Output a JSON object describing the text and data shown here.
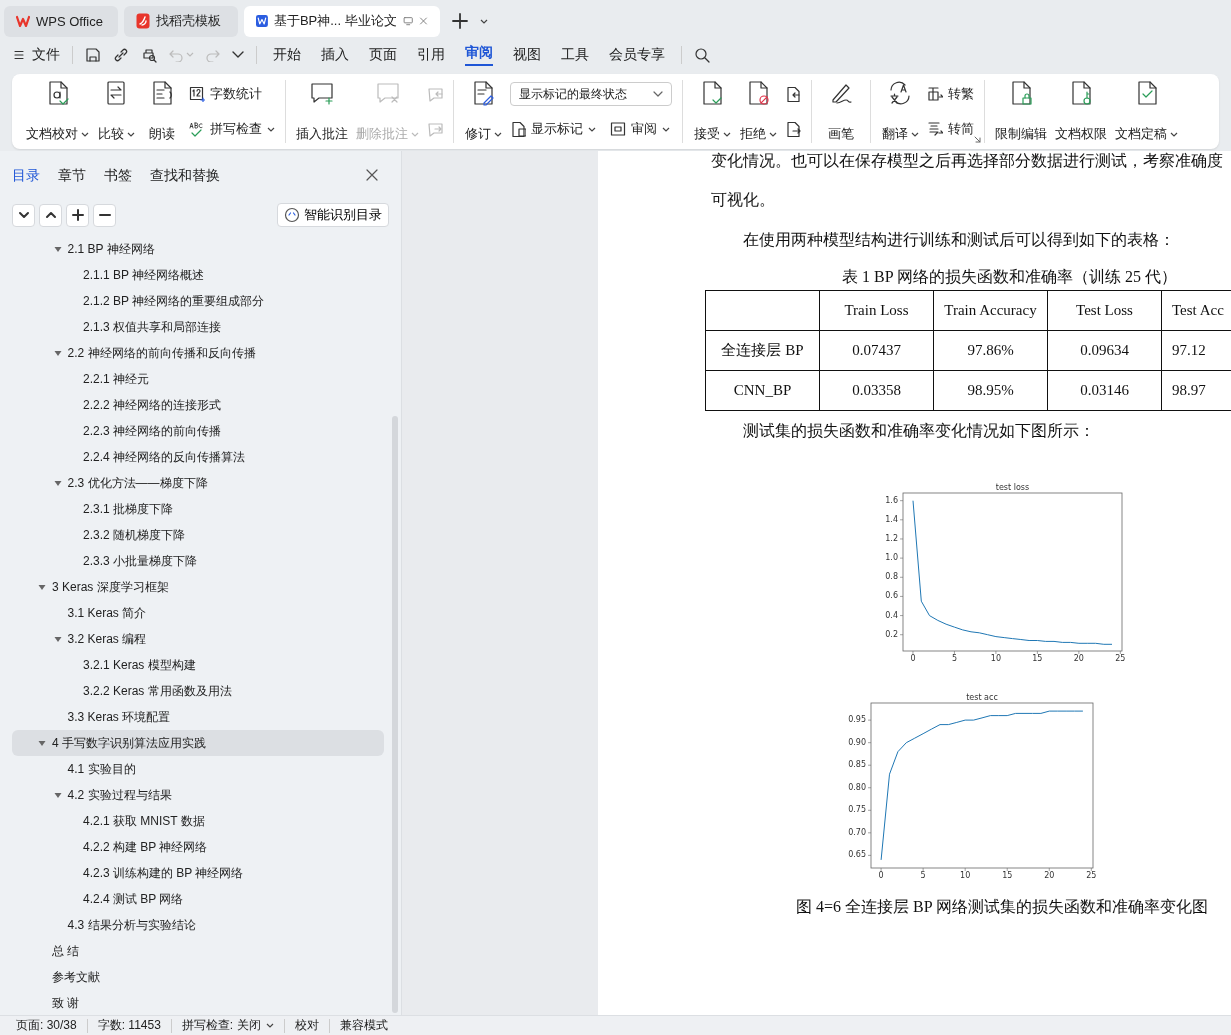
{
  "app_tabs": [
    {
      "kind": "home",
      "label": "WPS Office",
      "selected": false
    },
    {
      "kind": "template",
      "label": "找稻壳模板",
      "selected": false
    },
    {
      "kind": "doc",
      "label": "基于BP神... 毕业论文",
      "selected": true
    }
  ],
  "menu": {
    "file": "文件",
    "tabs": [
      {
        "label": "开始",
        "selected": false
      },
      {
        "label": "插入",
        "selected": false
      },
      {
        "label": "页面",
        "selected": false
      },
      {
        "label": "引用",
        "selected": false
      },
      {
        "label": "审阅",
        "selected": true
      },
      {
        "label": "视图",
        "selected": false
      },
      {
        "label": "工具",
        "selected": false
      },
      {
        "label": "会员专享",
        "selected": false
      }
    ]
  },
  "ribbon": {
    "groups": [
      {
        "items": [
          {
            "kind": "large",
            "label": "文档校对",
            "caret": true
          },
          {
            "kind": "large",
            "label": "比较",
            "caret": true
          },
          {
            "kind": "large",
            "label": "朗读"
          },
          {
            "kind": "stack",
            "items": [
              {
                "label": "字数统计"
              },
              {
                "label": "拼写检查",
                "caret": true
              }
            ]
          }
        ]
      },
      {
        "items": [
          {
            "kind": "large",
            "label": "插入批注"
          },
          {
            "kind": "large",
            "label": "删除批注",
            "caret": true,
            "disabled": true
          },
          {
            "kind": "stack",
            "items": [
              {
                "disabled": true
              },
              {
                "disabled": true
              }
            ]
          }
        ]
      },
      {
        "items": [
          {
            "kind": "large",
            "label": "修订",
            "caret": true
          },
          {
            "kind": "markup",
            "select": "显示标记的最终状态",
            "buttons": [
              {
                "label": "显示标记",
                "caret": true
              },
              {
                "label": "审阅",
                "caret": true
              }
            ]
          }
        ]
      },
      {
        "items": [
          {
            "kind": "large",
            "label": "接受",
            "caret": true
          },
          {
            "kind": "large",
            "label": "拒绝",
            "caret": true
          },
          {
            "kind": "stack",
            "items": [
              {
                "disabled": false
              },
              {
                "disabled": false
              }
            ]
          }
        ]
      },
      {
        "items": [
          {
            "kind": "large",
            "label": "画笔"
          }
        ]
      },
      {
        "launcher": true,
        "items": [
          {
            "kind": "large",
            "label": "翻译",
            "caret": true
          },
          {
            "kind": "stack",
            "items": [
              {
                "label": "转繁"
              },
              {
                "label": "转简"
              }
            ]
          }
        ]
      },
      {
        "items": [
          {
            "kind": "large",
            "label": "限制编辑"
          },
          {
            "kind": "large",
            "label": "文档权限"
          },
          {
            "kind": "large",
            "label": "文档定稿",
            "caret": true
          }
        ]
      }
    ]
  },
  "sidebar": {
    "tabs": [
      {
        "label": "目录",
        "selected": true
      },
      {
        "label": "章节",
        "selected": false
      },
      {
        "label": "书签",
        "selected": false
      },
      {
        "label": "查找和替换",
        "selected": false
      }
    ],
    "smart_button": "智能识别目录",
    "outline": [
      {
        "children": [
          {
            "label": "2.1 BP 神经网络",
            "expanded": true,
            "selected": false,
            "children": [
              {
                "label": "2.1.1 BP 神经网络概述",
                "selected": false
              },
              {
                "label": "2.1.2 BP 神经网络的重要组成部分",
                "selected": false
              },
              {
                "label": "2.1.3  权值共享和局部连接",
                "selected": false
              }
            ]
          },
          {
            "label": "2.2  神经网络的前向传播和反向传播",
            "expanded": true,
            "selected": false,
            "children": [
              {
                "label": "2.2.1  神经元",
                "selected": false
              },
              {
                "label": "2.2.2  神经网络的连接形式",
                "selected": false
              },
              {
                "label": "2.2.3  神经网络的前向传播",
                "selected": false
              },
              {
                "label": "2.2.4  神经网络的反向传播算法",
                "selected": false
              }
            ]
          },
          {
            "label": "2.3  优化方法——梯度下降",
            "expanded": true,
            "selected": false,
            "children": [
              {
                "label": "2.3.1  批梯度下降",
                "selected": false
              },
              {
                "label": "2.3.2  随机梯度下降",
                "selected": false
              },
              {
                "label": "2.3.3  小批量梯度下降",
                "selected": false
              }
            ]
          }
        ]
      },
      {
        "label": "3 Keras 深度学习框架",
        "expanded": true,
        "selected": false,
        "children": [
          {
            "label": "3.1 Keras 简介",
            "selected": false
          },
          {
            "label": "3.2 Keras 编程",
            "expanded": true,
            "selected": false,
            "children": [
              {
                "label": "3.2.1 Keras 模型构建",
                "selected": false
              },
              {
                "label": "3.2.2 Keras 常用函数及用法",
                "selected": false
              }
            ]
          },
          {
            "label": "3.3 Keras 环境配置",
            "selected": false
          }
        ]
      },
      {
        "label": "4  手写数字识别算法应用实践",
        "expanded": true,
        "selected": true,
        "children": [
          {
            "label": "4.1 实验目的",
            "selected": false
          },
          {
            "label": "4.2 实验过程与结果",
            "expanded": true,
            "selected": false,
            "children": [
              {
                "label": "4.2.1 获取 MNIST 数据",
                "selected": false
              },
              {
                "label": "4.2.2 构建 BP 神经网络",
                "selected": false
              },
              {
                "label": "4.2.3 训练构建的 BP 神经网络",
                "selected": false
              },
              {
                "label": "4.2.4 测试 BP 网络",
                "selected": false
              }
            ]
          },
          {
            "label": "4.3 结果分析与实验结论",
            "selected": false
          }
        ]
      },
      {
        "label": "总  结",
        "selected": false
      },
      {
        "label": "参考文献",
        "selected": false
      },
      {
        "label": "致  谢",
        "selected": false
      }
    ]
  },
  "document": {
    "paragraphs_before": [
      {
        "text": "变化情况。也可以在保存模型之后再选择部分数据进行测试，考察准确度",
        "indent": false
      },
      {
        "text": "可视化。",
        "indent": false
      },
      {
        "text": "在使用两种模型结构进行训练和测试后可以得到如下的表格：",
        "indent": true
      }
    ],
    "table_caption": "表 1 BP 网络的损失函数和准确率（训练 25 代）",
    "table": {
      "columns": [
        "",
        "Train Loss",
        "Train Accuracy",
        "Test Loss",
        "Test Acc"
      ],
      "rows": [
        [
          "全连接层 BP",
          "0.07437",
          "97.86%",
          "0.09634",
          "97.12"
        ],
        [
          "CNN_BP",
          "0.03358",
          "98.95%",
          "0.03146",
          "98.97"
        ]
      ]
    },
    "paragraph_after": "测试集的损失函数和准确率变化情况如下图所示：",
    "charts": [
      {
        "chart_data": {
          "type": "line",
          "title": "test loss",
          "x": [
            0,
            1,
            2,
            3,
            4,
            5,
            6,
            7,
            8,
            9,
            10,
            11,
            12,
            13,
            14,
            15,
            16,
            17,
            18,
            19,
            20,
            21,
            22,
            23,
            24
          ],
          "series": [
            {
              "color": "#1f77b4",
              "values": [
                1.6,
                0.55,
                0.4,
                0.35,
                0.31,
                0.28,
                0.25,
                0.23,
                0.22,
                0.2,
                0.18,
                0.17,
                0.16,
                0.15,
                0.14,
                0.14,
                0.13,
                0.13,
                0.12,
                0.12,
                0.11,
                0.11,
                0.11,
                0.1,
                0.1
              ]
            }
          ],
          "xlim": [
            -1.2,
            25.2
          ],
          "ylim": [
            0.03,
            1.68
          ],
          "xticks": [
            0,
            5,
            10,
            15,
            20,
            25
          ],
          "yticks": [
            {
              "value": 0.2,
              "label": "0.2"
            },
            {
              "value": 0.4,
              "label": "0.4"
            },
            {
              "value": 0.6,
              "label": "0.6"
            },
            {
              "value": 0.8,
              "label": "0.8"
            },
            {
              "value": 1.0,
              "label": "1.0"
            },
            {
              "value": 1.2,
              "label": "1.2"
            },
            {
              "value": 1.4,
              "label": "1.4"
            },
            {
              "value": 1.6,
              "label": "1.6"
            }
          ]
        }
      },
      {
        "chart_data": {
          "type": "line",
          "title": "test acc",
          "x": [
            0,
            1,
            2,
            3,
            4,
            5,
            6,
            7,
            8,
            9,
            10,
            11,
            12,
            13,
            14,
            15,
            16,
            17,
            18,
            19,
            20,
            21,
            22,
            23,
            24
          ],
          "series": [
            {
              "color": "#1f77b4",
              "values": [
                0.64,
                0.83,
                0.88,
                0.9,
                0.91,
                0.92,
                0.93,
                0.94,
                0.94,
                0.945,
                0.95,
                0.95,
                0.955,
                0.96,
                0.96,
                0.96,
                0.965,
                0.965,
                0.965,
                0.965,
                0.97,
                0.97,
                0.97,
                0.97,
                0.97
              ]
            }
          ],
          "xlim": [
            -1.2,
            25.2
          ],
          "ylim": [
            0.622,
            0.988
          ],
          "xticks": [
            0,
            5,
            10,
            15,
            20,
            25
          ],
          "yticks": [
            {
              "value": 0.65,
              "label": "0.65"
            },
            {
              "value": 0.7,
              "label": "0.70"
            },
            {
              "value": 0.75,
              "label": "0.75"
            },
            {
              "value": 0.8,
              "label": "0.80"
            },
            {
              "value": 0.85,
              "label": "0.85"
            },
            {
              "value": 0.9,
              "label": "0.90"
            },
            {
              "value": 0.95,
              "label": "0.95"
            }
          ]
        }
      }
    ],
    "figure_caption": "图 4=6  全连接层 BP 网络测试集的损失函数和准确率变化图"
  },
  "status_bar": [
    {
      "kind": "text",
      "label": "页面: 30/38"
    },
    {
      "kind": "text",
      "label": "字数: 11453"
    },
    {
      "kind": "dropdown",
      "label": "拼写检查: 关闭"
    },
    {
      "kind": "text",
      "label": "校对"
    },
    {
      "kind": "text",
      "label": "兼容模式"
    }
  ]
}
